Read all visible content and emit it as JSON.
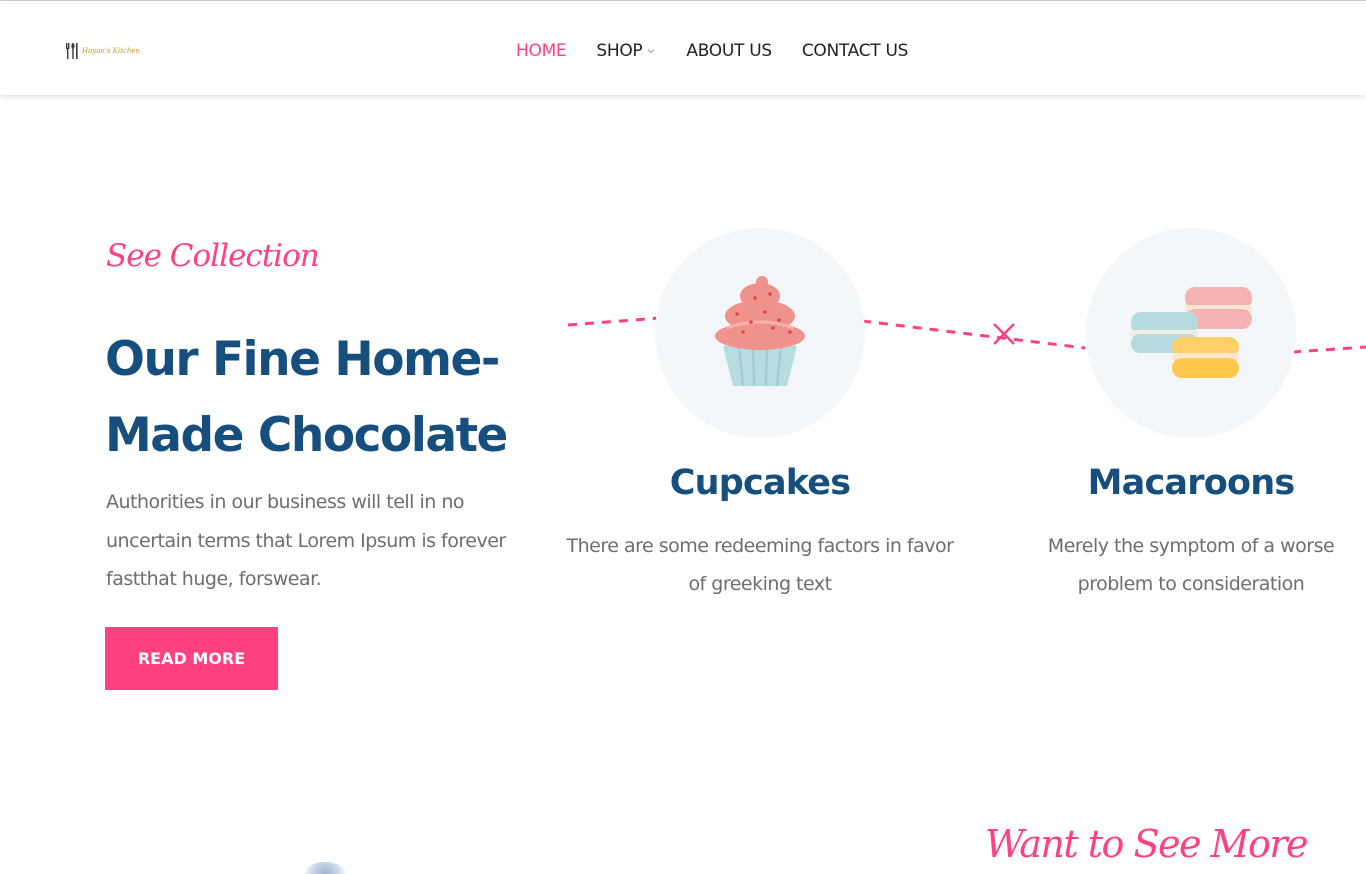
{
  "header": {
    "logo_text": "Hayan's Kitchen",
    "nav": [
      {
        "label": "HOME",
        "active": true
      },
      {
        "label": "SHOP",
        "has_dropdown": true
      },
      {
        "label": "ABOUT US"
      },
      {
        "label": "CONTACT US"
      }
    ]
  },
  "hero": {
    "eyebrow": "See Collection",
    "title": "Our Fine Home-Made Chocolate",
    "text": "Authorities in our business will tell in no uncertain terms that Lorem Ipsum is forever fastthat huge, forswear.",
    "button": "READ MORE"
  },
  "collection": [
    {
      "icon": "cupcake-icon",
      "title": "Cupcakes",
      "text": "There are some redeeming factors in favor of greeking text"
    },
    {
      "icon": "macaroon-icon",
      "title": "Macaroons",
      "text": "Merely the symptom of a worse problem to consideration"
    }
  ],
  "section2": {
    "title": "Want to See More"
  },
  "colors": {
    "accent": "#ff4181",
    "heading": "#164e7e",
    "body_text": "#6e6e6e",
    "circle_bg": "#f4f7f9"
  }
}
